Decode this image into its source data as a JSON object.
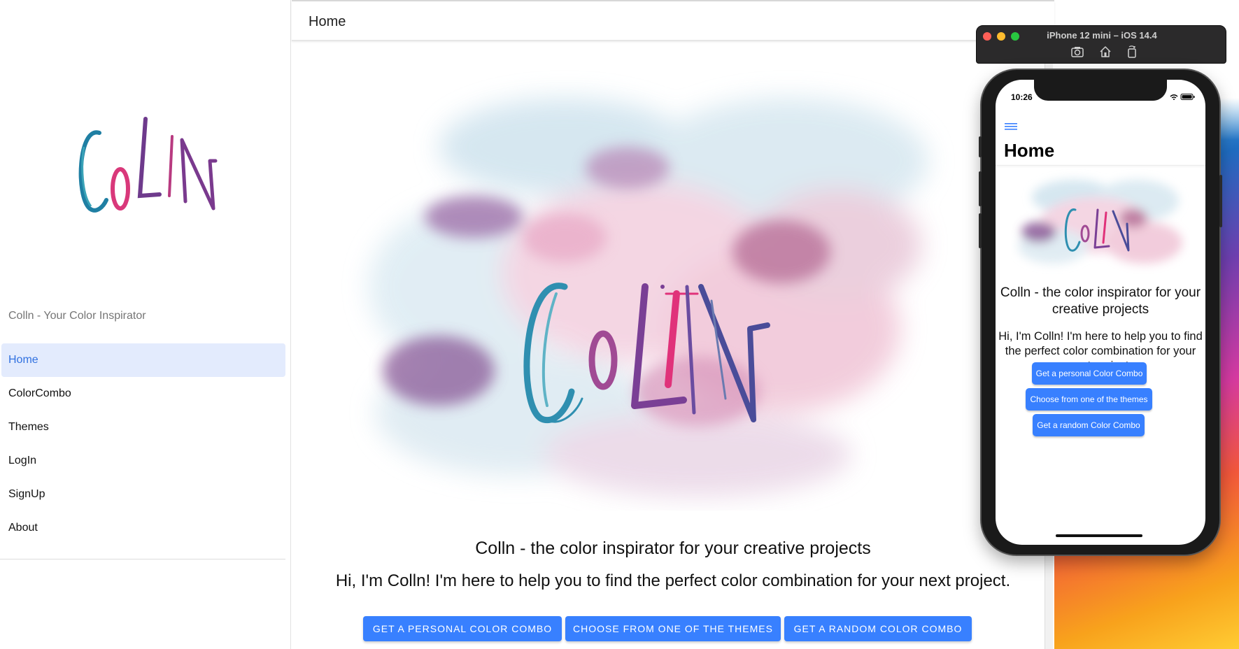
{
  "sidebar": {
    "subtitle": "Colln - Your Color Inspirator",
    "items": [
      {
        "label": "Home",
        "active": true
      },
      {
        "label": "ColorCombo",
        "active": false
      },
      {
        "label": "Themes",
        "active": false
      },
      {
        "label": "LogIn",
        "active": false
      },
      {
        "label": "SignUp",
        "active": false
      },
      {
        "label": "About",
        "active": false
      }
    ]
  },
  "main": {
    "title": "Home",
    "heading": "Colln - the color inspirator for your creative projects",
    "text": "Hi, I'm Colln! I'm here to help you to find the perfect color combination for your next project.",
    "buttons": {
      "personal": "GET A PERSONAL COLOR COMBO",
      "themes": "CHOOSE FROM ONE OF THE THEMES",
      "random": "GET A RANDOM COLOR COMBO"
    }
  },
  "simulator": {
    "title": "iPhone 12 mini – iOS 14.4"
  },
  "phone": {
    "time": "10:26",
    "title": "Home",
    "heading": "Colln - the color inspirator for your creative projects",
    "text": "Hi, I'm Colln! I'm here to help you to find the perfect color combination for your next project.",
    "buttons": {
      "personal": "Get a personal Color Combo",
      "themes": "Choose from one of the themes",
      "random": "Get a random Color Combo"
    }
  },
  "colors": {
    "accent": "#3880ff",
    "active_bg": "#e3ebfd",
    "active_text": "#3171e0",
    "logo_teal": "#1f7fa3",
    "logo_pink": "#d9387a",
    "logo_purple": "#6e3a8c"
  }
}
